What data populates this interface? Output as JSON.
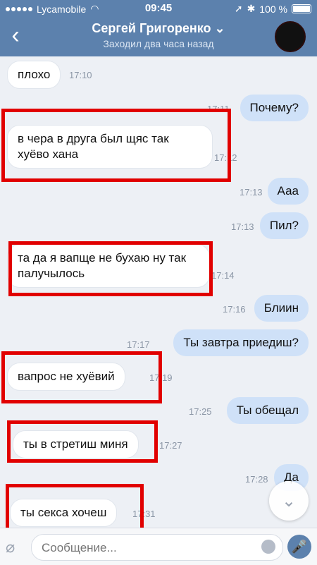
{
  "status_bar": {
    "carrier": "Lycamobile",
    "time": "09:45",
    "battery": "100 %"
  },
  "header": {
    "back_icon": "chevron-left-icon",
    "title": "Сергей Григоренко",
    "title_chevron": "chevron-down-icon",
    "subtitle": "Заходил два часа назад"
  },
  "messages": [
    {
      "dir": "in",
      "text": "плохо",
      "time": "17:10"
    },
    {
      "dir": "out",
      "text": "Почему?",
      "time": "17:11"
    },
    {
      "dir": "in",
      "text": "в чера в друга был щяс так хуёво хана",
      "time": "17:12"
    },
    {
      "dir": "out",
      "text": "Ааа",
      "time": "17:13"
    },
    {
      "dir": "out",
      "text": "Пил?",
      "time": "17:13"
    },
    {
      "dir": "in",
      "text": "та да я вапще не бухаю ну так палучылось",
      "time": "17:14"
    },
    {
      "dir": "out",
      "text": "Блиин",
      "time": "17:16"
    },
    {
      "dir": "out",
      "text": "Ты завтра приедиш?",
      "time": "17:17"
    },
    {
      "dir": "in",
      "text": "вапрос не хуёвий",
      "time": "17:19"
    },
    {
      "dir": "out",
      "text": "Ты обещал",
      "time": "17:25"
    },
    {
      "dir": "in",
      "text": "ты в стретиш миня",
      "time": "17:27"
    },
    {
      "dir": "out",
      "text": "Да",
      "time": "17:28"
    },
    {
      "dir": "in",
      "text": "ты секса хочеш",
      "time": "17:31"
    }
  ],
  "input_bar": {
    "placeholder": "Сообщение..."
  },
  "colors": {
    "header": "#5c81ad",
    "outgoing_bubble": "#cfe1f8",
    "highlight": "#e10000"
  }
}
